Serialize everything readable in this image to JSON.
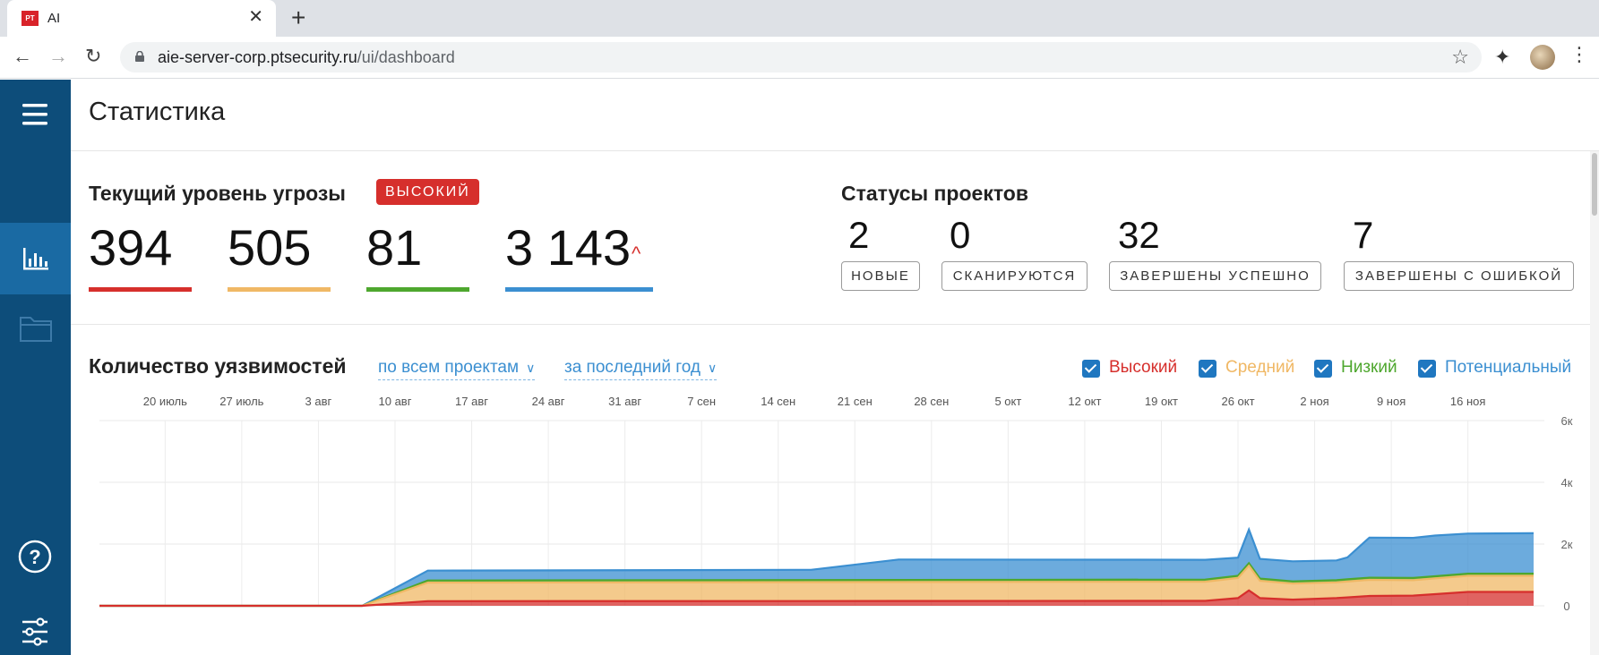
{
  "browser": {
    "tab_title": "AI",
    "tab_favicon_text": "PT",
    "url_host": "aie-server-corp.ptsecurity.ru",
    "url_path": "/ui/dashboard"
  },
  "page": {
    "title": "Статистика"
  },
  "threat": {
    "title": "Текущий уровень угрозы",
    "badge": "ВЫСОКИЙ",
    "counts": [
      {
        "value": "394",
        "color": "#d62f2c"
      },
      {
        "value": "505",
        "color": "#f0b865"
      },
      {
        "value": "81",
        "color": "#4ea72e"
      },
      {
        "value": "3 143",
        "color": "#3b8fd1"
      }
    ]
  },
  "projects": {
    "title": "Статусы проектов",
    "stats": [
      {
        "value": "2",
        "label": "НОВЫЕ"
      },
      {
        "value": "0",
        "label": "СКАНИРУЮТСЯ"
      },
      {
        "value": "32",
        "label": "ЗАВЕРШЕНЫ УСПЕШНО"
      },
      {
        "value": "7",
        "label": "ЗАВЕРШЕНЫ С ОШИБКОЙ"
      }
    ]
  },
  "vulns": {
    "title": "Количество уязвимостей",
    "filter_scope": "по всем проектам",
    "filter_period": "за последний год",
    "legend": [
      {
        "label": "Высокий",
        "color": "#d62f2c"
      },
      {
        "label": "Средний",
        "color": "#f0b865"
      },
      {
        "label": "Низкий",
        "color": "#4ea72e"
      },
      {
        "label": "Потенциальный",
        "color": "#3b8fd1"
      }
    ]
  },
  "chart_data": {
    "type": "area",
    "x_ticks": [
      "20 июль",
      "27 июль",
      "3 авг",
      "10 авг",
      "17 авг",
      "24 авг",
      "31 авг",
      "7 сен",
      "14 сен",
      "21 сен",
      "28 сен",
      "5 окт",
      "12 окт",
      "19 окт",
      "26 окт",
      "2 ноя",
      "9 ноя",
      "16 ноя"
    ],
    "y_ticks": [
      "6к",
      "4к",
      "2к",
      "0"
    ],
    "ylim": [
      0,
      6000
    ],
    "x_days_range": [
      -6,
      125
    ],
    "grid": true,
    "series": [
      {
        "name": "Высокий",
        "color": "#d62f2c",
        "points": [
          [
            -6,
            0
          ],
          [
            18,
            0
          ],
          [
            24,
            150
          ],
          [
            95,
            160
          ],
          [
            98,
            250
          ],
          [
            99,
            500
          ],
          [
            100,
            250
          ],
          [
            103,
            200
          ],
          [
            107,
            250
          ],
          [
            110,
            320
          ],
          [
            114,
            330
          ],
          [
            119,
            450
          ],
          [
            125,
            450
          ]
        ]
      },
      {
        "name": "Средний",
        "color": "#f0b865",
        "points": [
          [
            -6,
            0
          ],
          [
            18,
            0
          ],
          [
            24,
            600
          ],
          [
            95,
            620
          ],
          [
            98,
            650
          ],
          [
            99,
            800
          ],
          [
            100,
            560
          ],
          [
            103,
            520
          ],
          [
            107,
            510
          ],
          [
            110,
            520
          ],
          [
            114,
            500
          ],
          [
            119,
            520
          ],
          [
            125,
            520
          ]
        ]
      },
      {
        "name": "Низкий",
        "color": "#4ea72e",
        "points": [
          [
            -6,
            0
          ],
          [
            18,
            0
          ],
          [
            24,
            70
          ],
          [
            95,
            70
          ],
          [
            98,
            70
          ],
          [
            99,
            80
          ],
          [
            100,
            70
          ],
          [
            103,
            70
          ],
          [
            107,
            70
          ],
          [
            110,
            70
          ],
          [
            114,
            70
          ],
          [
            119,
            70
          ],
          [
            125,
            70
          ]
        ]
      },
      {
        "name": "Потенциальный",
        "color": "#3b8fd1",
        "points": [
          [
            -6,
            0
          ],
          [
            18,
            0
          ],
          [
            24,
            320
          ],
          [
            59,
            330
          ],
          [
            67,
            660
          ],
          [
            95,
            640
          ],
          [
            98,
            590
          ],
          [
            99,
            1090
          ],
          [
            100,
            640
          ],
          [
            103,
            650
          ],
          [
            107,
            640
          ],
          [
            108,
            710
          ],
          [
            110,
            1300
          ],
          [
            114,
            1300
          ],
          [
            116,
            1320
          ],
          [
            119,
            1300
          ],
          [
            125,
            1310
          ]
        ]
      }
    ],
    "x_ticks_days": [
      0,
      7,
      14,
      21,
      28,
      35,
      42,
      49,
      56,
      63,
      70,
      77,
      84,
      91,
      98,
      105,
      112,
      119
    ]
  }
}
